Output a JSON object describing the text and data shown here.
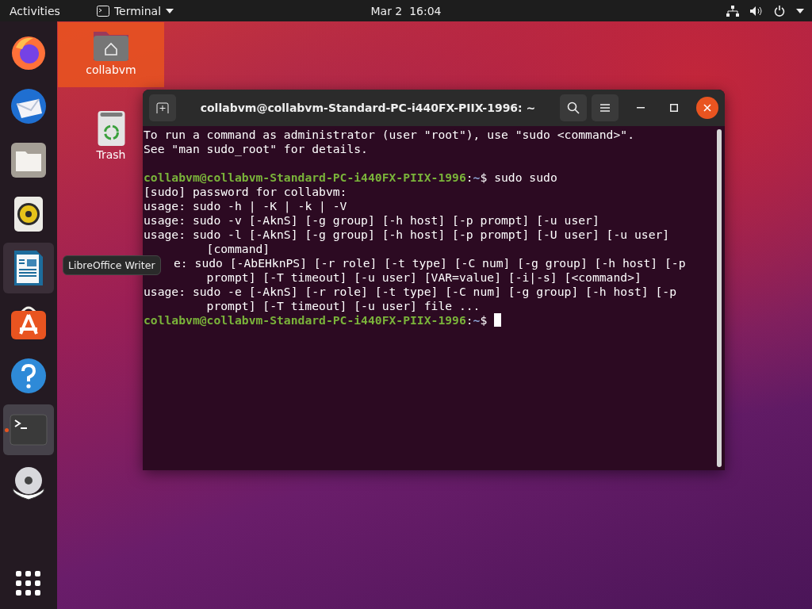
{
  "top_bar": {
    "activities": "Activities",
    "app_menu": "Terminal",
    "clock": "Mar 2  16:04"
  },
  "dock": {
    "items": [
      {
        "kind": "firefox",
        "selected": false,
        "hovered": false,
        "running": false
      },
      {
        "kind": "mail",
        "selected": false,
        "hovered": false,
        "running": false
      },
      {
        "kind": "files",
        "selected": false,
        "hovered": false,
        "running": false
      },
      {
        "kind": "speaker",
        "selected": false,
        "hovered": false,
        "running": false
      },
      {
        "kind": "writer",
        "selected": false,
        "hovered": true,
        "running": false
      },
      {
        "kind": "store",
        "selected": false,
        "hovered": false,
        "running": false
      },
      {
        "kind": "help",
        "selected": false,
        "hovered": false,
        "running": false
      },
      {
        "kind": "terminal",
        "selected": true,
        "hovered": false,
        "running": true
      },
      {
        "kind": "dvd",
        "selected": false,
        "hovered": false,
        "running": false
      }
    ]
  },
  "desktop_icons": [
    {
      "kind": "home",
      "label": "collabvm",
      "selected": true
    },
    {
      "kind": "trash",
      "label": "Trash",
      "selected": false
    }
  ],
  "terminal": {
    "title": "collabvm@collabvm-Standard-PC-i440FX-PIIX-1996: ~",
    "lines": [
      {
        "kind": "output",
        "text": "To run a command as administrator (user \"root\"), use \"sudo <command>\"."
      },
      {
        "kind": "output",
        "text": "See \"man sudo_root\" for details."
      },
      {
        "kind": "blank"
      },
      {
        "kind": "prompt",
        "user_host": "collabvm@collabvm-Standard-PC-i440FX-PIIX-1996",
        "sep": ":",
        "path": "~",
        "symbol": "$",
        "command": "sudo sudo"
      },
      {
        "kind": "output",
        "text": "[sudo] password for collabvm:"
      },
      {
        "kind": "output",
        "text": "usage: sudo -h | -K | -k | -V"
      },
      {
        "kind": "output",
        "text": "usage: sudo -v [-AknS] [-g group] [-h host] [-p prompt] [-u user]"
      },
      {
        "kind": "output",
        "text": "usage: sudo -l [-AknS] [-g group] [-h host] [-p prompt] [-U user] [-u user]"
      },
      {
        "kind": "continuation",
        "text": "[command]"
      },
      {
        "kind": "covered",
        "text": "e: sudo [-AbEHknPS] [-r role] [-t type] [-C num] [-g group] [-h host] [-p"
      },
      {
        "kind": "continuation",
        "text": "prompt] [-T timeout] [-u user] [VAR=value] [-i|-s] [<command>]"
      },
      {
        "kind": "output",
        "text": "usage: sudo -e [-AknS] [-r role] [-t type] [-C num] [-g group] [-h host] [-p"
      },
      {
        "kind": "continuation",
        "text": "prompt] [-T timeout] [-u user] file ..."
      },
      {
        "kind": "prompt",
        "user_host": "collabvm@collabvm-Standard-PC-i440FX-PIIX-1996",
        "sep": ":",
        "path": "~",
        "symbol": "$",
        "cursor": true
      }
    ]
  },
  "tooltip": {
    "text": "LibreOffice Writer"
  }
}
